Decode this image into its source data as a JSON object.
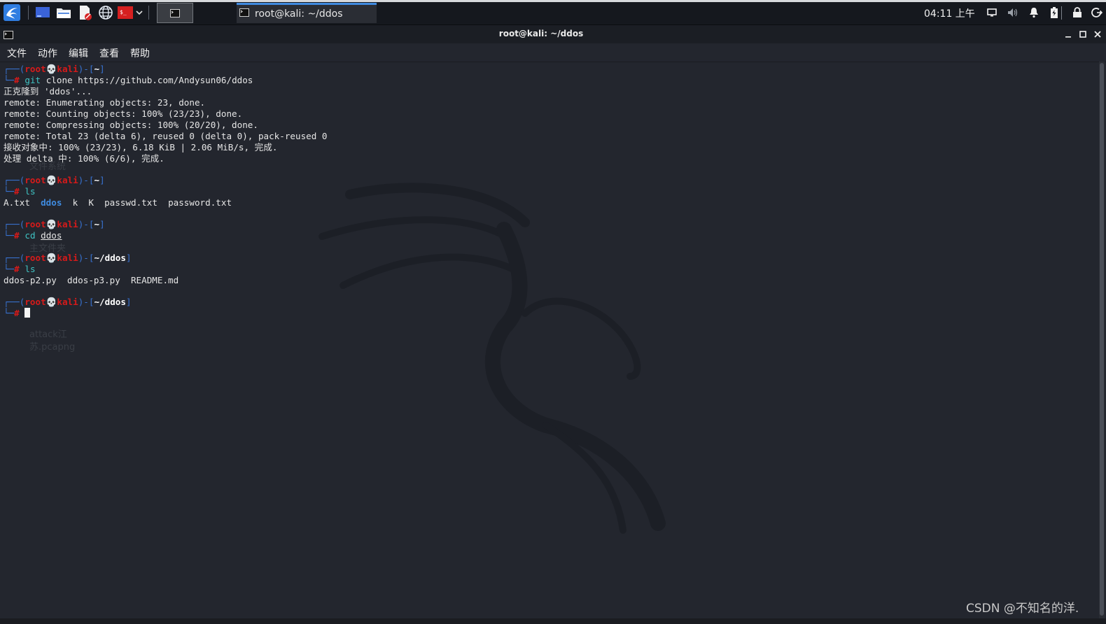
{
  "panel": {
    "task_title": "root@kali: ~/ddos",
    "clock": "04:11 上午"
  },
  "window": {
    "title": "root@kali: ~/ddos"
  },
  "menu": [
    "文件",
    "动作",
    "编辑",
    "查看",
    "帮助"
  ],
  "terminal": {
    "prompt": {
      "open": "┌──(",
      "user": "root",
      "skull": "💀",
      "host": "kali",
      "mid": ")-[",
      "close": "]",
      "corner": "└─",
      "hash": "#"
    },
    "home_dir": "~",
    "ddos_dir": "~/ddos",
    "cmd_git": "git",
    "cmd_git_args": " clone https://github.com/Andysun06/ddos",
    "clone_output": [
      "正克隆到 'ddos'...",
      "remote: Enumerating objects: 23, done.",
      "remote: Counting objects: 100% (23/23), done.",
      "remote: Compressing objects: 100% (20/20), done.",
      "remote: Total 23 (delta 6), reused 0 (delta 0), pack-reused 0",
      "接收对象中: 100% (23/23), 6.18 KiB | 2.06 MiB/s, 完成.",
      "处理 delta 中: 100% (6/6), 完成."
    ],
    "cmd_ls": "ls",
    "ls1_a": "A.txt  ",
    "ls1_dir": "ddos",
    "ls1_b": "  k  K  passwd.txt  password.txt",
    "cmd_cd": "cd",
    "cd_arg": "ddos",
    "ls2": "ddos-p2.py  ddos-p3.py  README.md"
  },
  "ghost_labels": [
    "文件系统",
    "主文件夹",
    "attack江苏.pcapng"
  ],
  "watermark": "CSDN @不知名的洋."
}
